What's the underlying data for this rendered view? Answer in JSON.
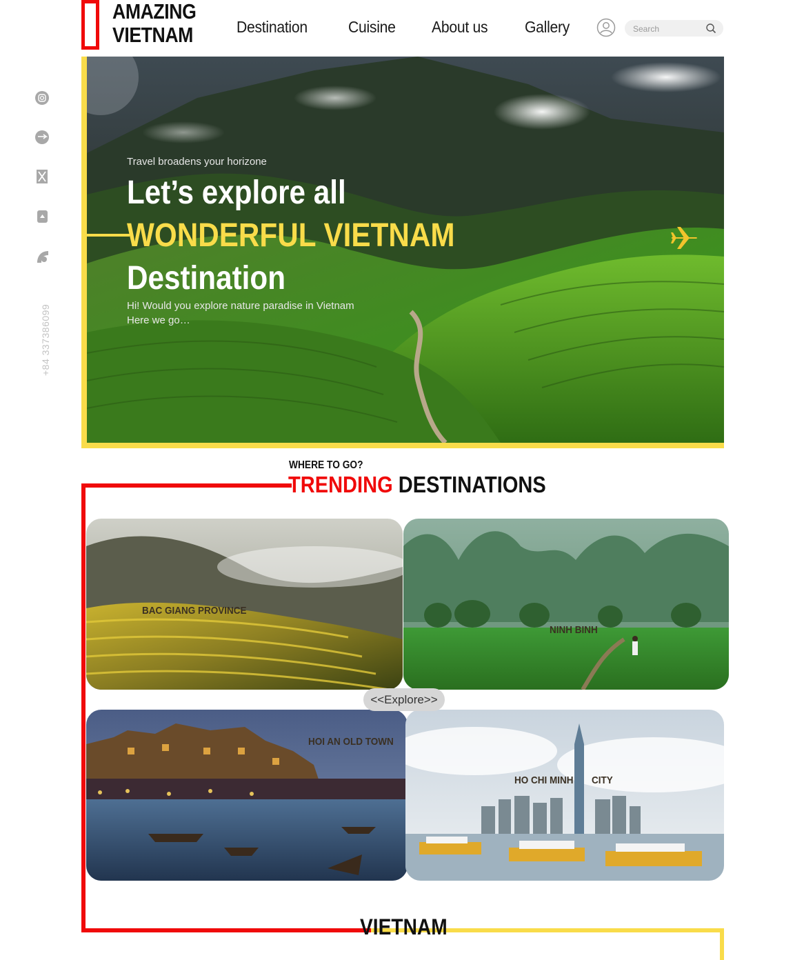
{
  "brand": {
    "line1": "AMAZING",
    "line2": "VIETNAM"
  },
  "nav": [
    {
      "label": "Destination"
    },
    {
      "label": "Cuisine"
    },
    {
      "label": "About us"
    },
    {
      "label": "Gallery"
    }
  ],
  "search": {
    "placeholder": "Search"
  },
  "social": [
    "instagram-icon",
    "pinterest-icon",
    "x-icon",
    "app-icon",
    "rss-icon"
  ],
  "contact": {
    "phone": "+84 337386099"
  },
  "hero": {
    "tagline": "Travel broadens your horizone",
    "line1": "Let’s explore all",
    "line2": "WONDERFUL VIETNAM",
    "line3": "Destination",
    "desc1": "Hi! Would you explore nature paradise in Vietnam",
    "desc2": "Here we go…"
  },
  "trending": {
    "subtitle": "WHERE TO GO?",
    "title_accent": "TRENDING",
    "title_rest": "DESTINATIONS",
    "cards": [
      {
        "label": "BAC GIANG PROVINCE"
      },
      {
        "label": "NINH BINH"
      },
      {
        "label": "HOI AN OLD TOWN"
      },
      {
        "label_left": "HO CHI MINH",
        "label_right": "CITY"
      }
    ],
    "explore": "<<Explore>>"
  },
  "footer": {
    "title": "VIETNAM"
  },
  "colors": {
    "accent_red": "#f00a0a",
    "accent_yellow": "#f9dc4a"
  }
}
